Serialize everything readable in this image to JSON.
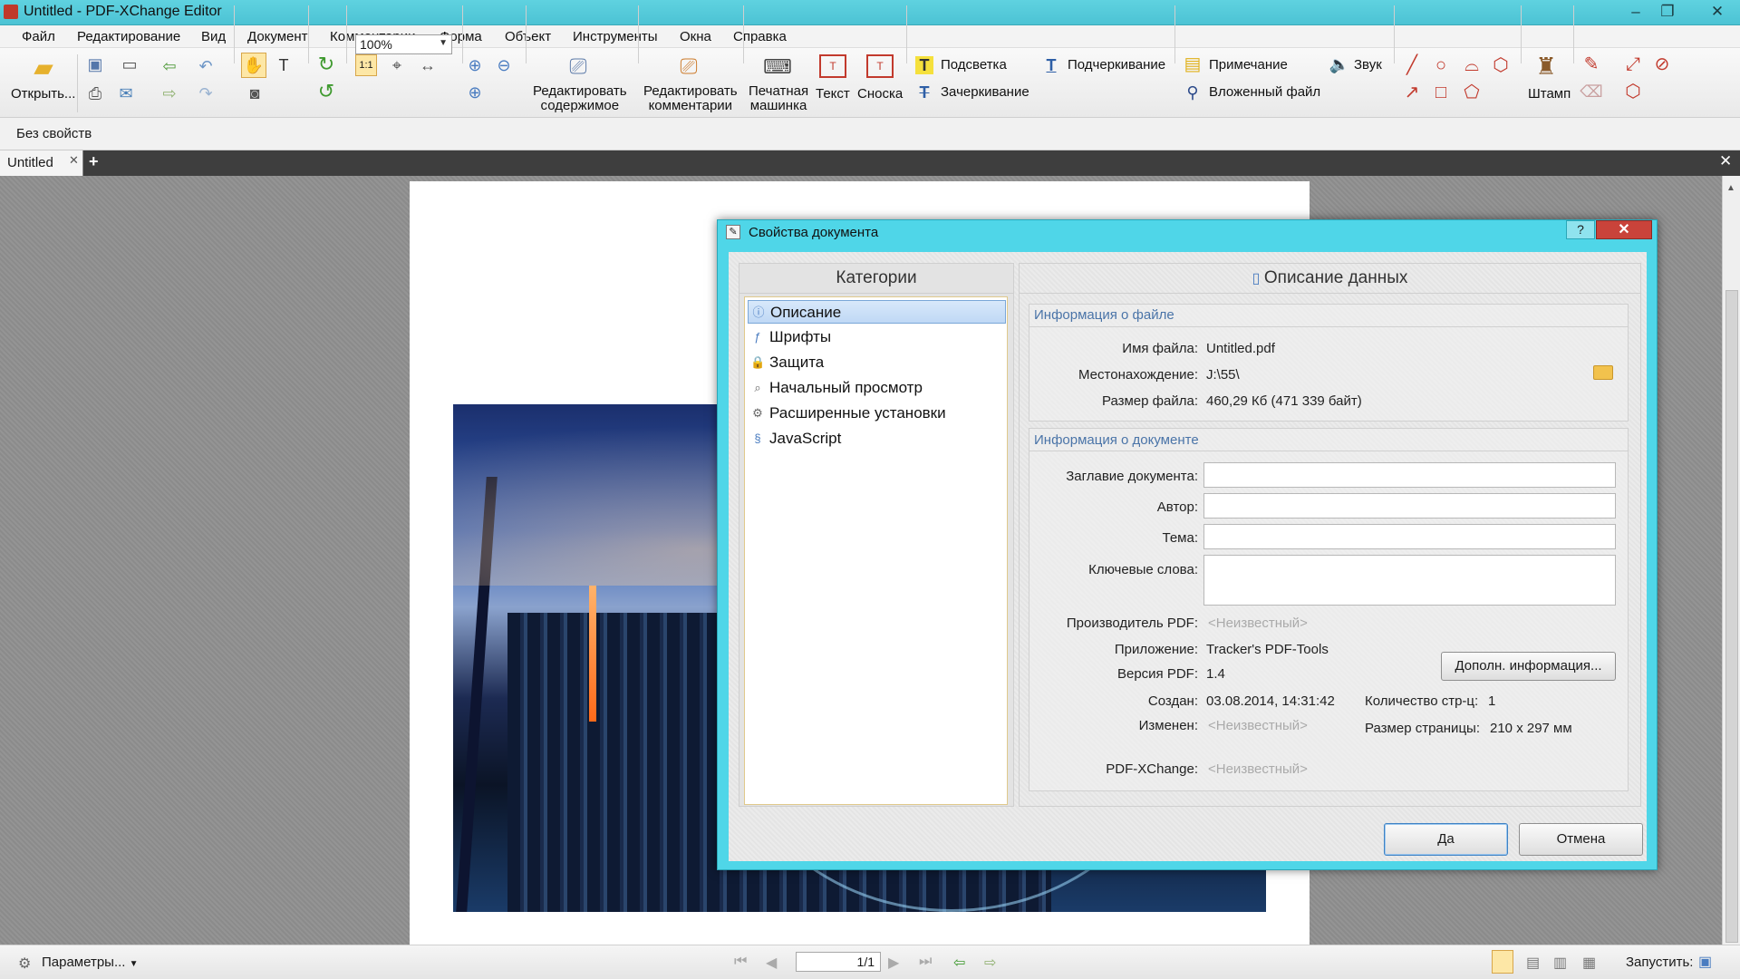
{
  "window": {
    "title": "Untitled - PDF-XChange Editor"
  },
  "menu": [
    "Файл",
    "Редактирование",
    "Вид",
    "Документ",
    "Комментарии",
    "Форма",
    "Объект",
    "Инструменты",
    "Окна",
    "Справка"
  ],
  "toolbar": {
    "open_label": "Открыть...",
    "zoom_value": "100%",
    "edit_content": [
      "Редактировать",
      "содержимое"
    ],
    "edit_comments": [
      "Редактировать",
      "комментарии"
    ],
    "typewriter": [
      "Печатная",
      "машинка"
    ],
    "text": "Текст",
    "callout": "Сноска",
    "highlight": "Подсветка",
    "strikeout": "Зачеркивание",
    "underline": "Подчеркивание",
    "note": "Примечание",
    "attachment": "Вложенный файл",
    "sound": "Звук",
    "stamp": "Штамп"
  },
  "properties_bar": {
    "text": "Без свойств"
  },
  "tabs": {
    "doc_tab": "Untitled"
  },
  "status": {
    "params": "Параметры...",
    "page": "1/1",
    "run": "Запустить:"
  },
  "dialog": {
    "title": "Свойства документа",
    "categories_header": "Категории",
    "categories": [
      "Описание",
      "Шрифты",
      "Защита",
      "Начальный просмотр",
      "Расширенные установки",
      "JavaScript"
    ],
    "section_header": "Описание данных",
    "file_info": {
      "header": "Информация о файле",
      "name_label": "Имя файла:",
      "name_value": "Untitled.pdf",
      "location_label": "Местонахождение:",
      "location_value": "J:\\55\\",
      "size_label": "Размер файла:",
      "size_value": "460,29 Кб (471 339 байт)"
    },
    "doc_info": {
      "header": "Информация о документе",
      "title_label": "Заглавие документа:",
      "author_label": "Автор:",
      "subject_label": "Тема:",
      "keywords_label": "Ключевые слова:",
      "producer_label": "Производитель PDF:",
      "producer_value": "<Неизвестный>",
      "app_label": "Приложение:",
      "app_value": "Tracker's PDF-Tools",
      "version_label": "Версия PDF:",
      "version_value": "1.4",
      "created_label": "Создан:",
      "created_value": "03.08.2014, 14:31:42",
      "modified_label": "Изменен:",
      "modified_value": "<Неизвестный>",
      "pdfx_label": "PDF-XChange:",
      "pdfx_value": "<Неизвестный>",
      "pages_label": "Количество стр-ц:",
      "pages_value": "1",
      "pagesize_label": "Размер страницы:",
      "pagesize_value": "210 x 297 мм",
      "more_button": "Дополн. информация..."
    },
    "ok_button": "Да",
    "cancel_button": "Отмена"
  }
}
